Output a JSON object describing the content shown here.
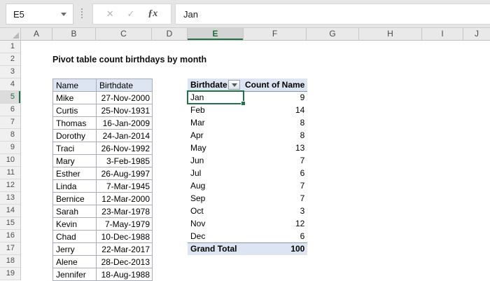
{
  "formula_bar": {
    "name_box": "E5",
    "cancel_label": "✕",
    "enter_label": "✓",
    "fx_label": "ƒx",
    "value": "Jan"
  },
  "grid": {
    "column_headers": [
      "A",
      "B",
      "C",
      "D",
      "E",
      "F",
      "G",
      "H",
      "I",
      "J"
    ],
    "row_headers": [
      "1",
      "2",
      "3",
      "4",
      "5",
      "6",
      "7",
      "8",
      "9",
      "10",
      "11",
      "12",
      "13",
      "14",
      "15",
      "16",
      "17",
      "18",
      "19"
    ],
    "selected_column": "E",
    "selected_row": "5"
  },
  "sheet": {
    "title": "Pivot table count birthdays by month",
    "source_table": {
      "name_header": "Name",
      "birthdate_header": "Birthdate",
      "rows": [
        [
          "Mike",
          "27-Nov-2000"
        ],
        [
          "Curtis",
          "25-Nov-1931"
        ],
        [
          "Thomas",
          "16-Jan-2009"
        ],
        [
          "Dorothy",
          "24-Jan-2014"
        ],
        [
          "Traci",
          "26-Nov-1992"
        ],
        [
          "Mary",
          "3-Feb-1985"
        ],
        [
          "Esther",
          "26-Aug-1997"
        ],
        [
          "Linda",
          "7-Mar-1945"
        ],
        [
          "Bernice",
          "12-Mar-2000"
        ],
        [
          "Sarah",
          "23-Mar-1978"
        ],
        [
          "Kevin",
          "7-May-1979"
        ],
        [
          "Chad",
          "10-Dec-1988"
        ],
        [
          "Jerry",
          "22-Mar-2017"
        ],
        [
          "Alene",
          "28-Dec-2013"
        ],
        [
          "Jennifer",
          "18-Aug-1988"
        ]
      ]
    },
    "pivot": {
      "row_field_header": "Birthdate",
      "value_field_header": "Count of Name",
      "rows": [
        [
          "Jan",
          9
        ],
        [
          "Feb",
          14
        ],
        [
          "Mar",
          8
        ],
        [
          "Apr",
          8
        ],
        [
          "May",
          13
        ],
        [
          "Jun",
          7
        ],
        [
          "Jul",
          6
        ],
        [
          "Aug",
          7
        ],
        [
          "Sep",
          7
        ],
        [
          "Oct",
          3
        ],
        [
          "Nov",
          12
        ],
        [
          "Dec",
          6
        ]
      ],
      "grand_total_label": "Grand Total",
      "grand_total_value": 100
    }
  },
  "colors": {
    "accent_green": "#217346",
    "header_fill": "#dce5f1",
    "table_border": "#a6adb8",
    "pivot_accent_border": "#8496b0",
    "chrome_gray": "#e6e6e6"
  }
}
